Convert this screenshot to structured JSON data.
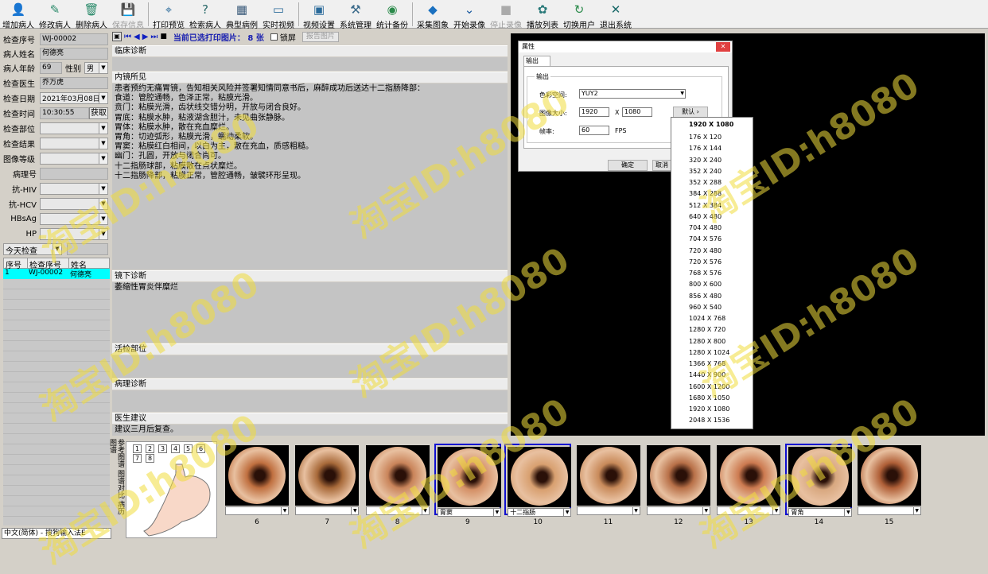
{
  "toolbar": [
    {
      "label": "增加病人",
      "icon": "add-patient-icon",
      "disabled": false
    },
    {
      "label": "修改病人",
      "icon": "edit-patient-icon",
      "disabled": false
    },
    {
      "label": "删除病人",
      "icon": "delete-patient-icon",
      "disabled": false
    },
    {
      "label": "保存信息",
      "icon": "save-icon",
      "disabled": true
    },
    {
      "label": "打印预览",
      "icon": "print-preview-icon",
      "disabled": false
    },
    {
      "label": "检索病人",
      "icon": "search-patient-icon",
      "disabled": false
    },
    {
      "label": "典型病例",
      "icon": "typical-case-icon",
      "disabled": false
    },
    {
      "label": "实时视频",
      "icon": "video-icon",
      "disabled": false
    },
    {
      "label": "视频设置",
      "icon": "video-settings-icon",
      "disabled": false
    },
    {
      "label": "系统管理",
      "icon": "system-tools-icon",
      "disabled": false
    },
    {
      "label": "统计备份",
      "icon": "backup-icon",
      "disabled": false
    },
    {
      "label": "采集图象",
      "icon": "capture-icon",
      "disabled": false
    },
    {
      "label": "开始录像",
      "icon": "record-icon",
      "disabled": false
    },
    {
      "label": "停止录像",
      "icon": "stop-icon",
      "disabled": true
    },
    {
      "label": "播放列表",
      "icon": "playlist-icon",
      "disabled": false
    },
    {
      "label": "切换用户",
      "icon": "switch-user-icon",
      "disabled": false
    },
    {
      "label": "退出系统",
      "icon": "exit-icon",
      "disabled": false
    }
  ],
  "patient": {
    "exam_no_label": "检查序号",
    "exam_no": "WJ-00002",
    "name_label": "病人姓名",
    "name": "何德亮",
    "age_label": "病人年龄",
    "age": "69",
    "sex_label": "性别",
    "sex": "男",
    "doctor_label": "检查医生",
    "doctor": "乔万虎",
    "date_label": "检查日期",
    "date": "2021年03月08日",
    "time_label": "检查时间",
    "time": "10:30:55",
    "fetch_label": "获取",
    "site_label": "检查部位",
    "result_label": "检查结果",
    "grade_label": "图像等级",
    "path_no_label": "病理号",
    "hiv_label": "抗-HIV",
    "hcv_label": "抗-HCV",
    "hbsag_label": "HBsAg",
    "hp_label": "HP"
  },
  "filter": {
    "value": "今天检查"
  },
  "patient_list": {
    "headers": [
      "序号",
      "检查序号",
      "姓名"
    ],
    "rows": [
      [
        "1",
        "WJ-00002",
        "何德亮"
      ]
    ]
  },
  "ime_status": "中文(简体) - 搜狗输入法E",
  "nav": {
    "selected_text": "当前已选打印图片： 8 张",
    "lock_label": "锁屏",
    "report_label": "报告图片"
  },
  "sections": {
    "clinical": "临床诊断",
    "endoscopy": "内镜所见",
    "endoscopy_text": "患者预约无痛胃镜，告知相关风险并签署知情同意书后，麻醉成功后送达十二指肠降部：\n食道：管腔通畅，色泽正常，粘膜光滑。\n贲门：粘膜光滑，齿状线交错分明，开放与闭合良好。\n胃底：粘膜水肿，粘液湖含胆汁，未见曲张静脉。\n胃体：粘膜水肿，散在充血糜烂。\n胃角：切迹弧形，粘膜光滑，蠕动柔软。\n胃窦：粘膜红白相间，以白为主，散在充血，质感粗糙。\n幽门：孔圆，开放与闭合尚可。\n十二指肠球部，粘膜散在点状糜烂。\n十二指肠降部，粘膜正常，管腔通畅，皱襞环形呈现。",
    "diagnosis": "镜下诊断",
    "diagnosis_text": "萎缩性胃炎伴糜烂",
    "biopsy": "活检部位",
    "pathology": "病理诊断",
    "advice": "医生建议",
    "advice_text": "建议三月后复查。"
  },
  "dialog": {
    "title": "属性",
    "tab": "输出",
    "group": "输出",
    "color_label": "色彩空间:",
    "color_value": "YUY2",
    "size_label": "图像大小:",
    "width": "1920",
    "x": "X",
    "height": "1080",
    "default_label": "默认",
    "fps_label": "帧率:",
    "fps": "60",
    "fps_unit": "FPS",
    "ok_label": "确定",
    "cancel_label": "取消"
  },
  "resolutions": {
    "current": "1920 X 1080",
    "items": [
      "176 X 120",
      "176 X 144",
      "320 X 240",
      "352 X 240",
      "352 X 288",
      "384 X 288",
      "512 X 384",
      "640 X 480",
      "704 X 480",
      "704 X 576",
      "720 X 480",
      "720 X 576",
      "768 X 576",
      "800 X 600",
      "856 X 480",
      "960 X 540",
      "1024 X 768",
      "1280 X 720",
      "1280 X 800",
      "1280 X 1024",
      "1366 X 768",
      "1440 X 900",
      "1600 X 1200",
      "1680 X 1050",
      "1920 X 1080",
      "2048 X 1536"
    ]
  },
  "side_tabs": [
    "参考图谱",
    "图谱对比",
    "病历图谱"
  ],
  "map_numbers": [
    "1",
    "2",
    "3",
    "4",
    "5",
    "6",
    "7",
    "8"
  ],
  "thumbs": [
    {
      "num": "6",
      "caption": "",
      "selected": false,
      "color": "#c07040"
    },
    {
      "num": "7",
      "caption": "",
      "selected": false,
      "color": "#a86a3a"
    },
    {
      "num": "8",
      "caption": "",
      "selected": false,
      "color": "#c9845a"
    },
    {
      "num": "9",
      "caption": "胃窦",
      "selected": true,
      "color": "#d49066"
    },
    {
      "num": "10",
      "caption": "十二指肠",
      "selected": true,
      "color": "#d8a070"
    },
    {
      "num": "11",
      "caption": "",
      "selected": false,
      "color": "#c88a5a"
    },
    {
      "num": "12",
      "caption": "",
      "selected": false,
      "color": "#b87048"
    },
    {
      "num": "13",
      "caption": "",
      "selected": false,
      "color": "#cc7a50"
    },
    {
      "num": "14",
      "caption": "胃角",
      "selected": true,
      "color": "#d8a880"
    },
    {
      "num": "15",
      "caption": "",
      "selected": false,
      "color": "#b06038"
    }
  ],
  "watermark": "淘宝ID:h8080"
}
